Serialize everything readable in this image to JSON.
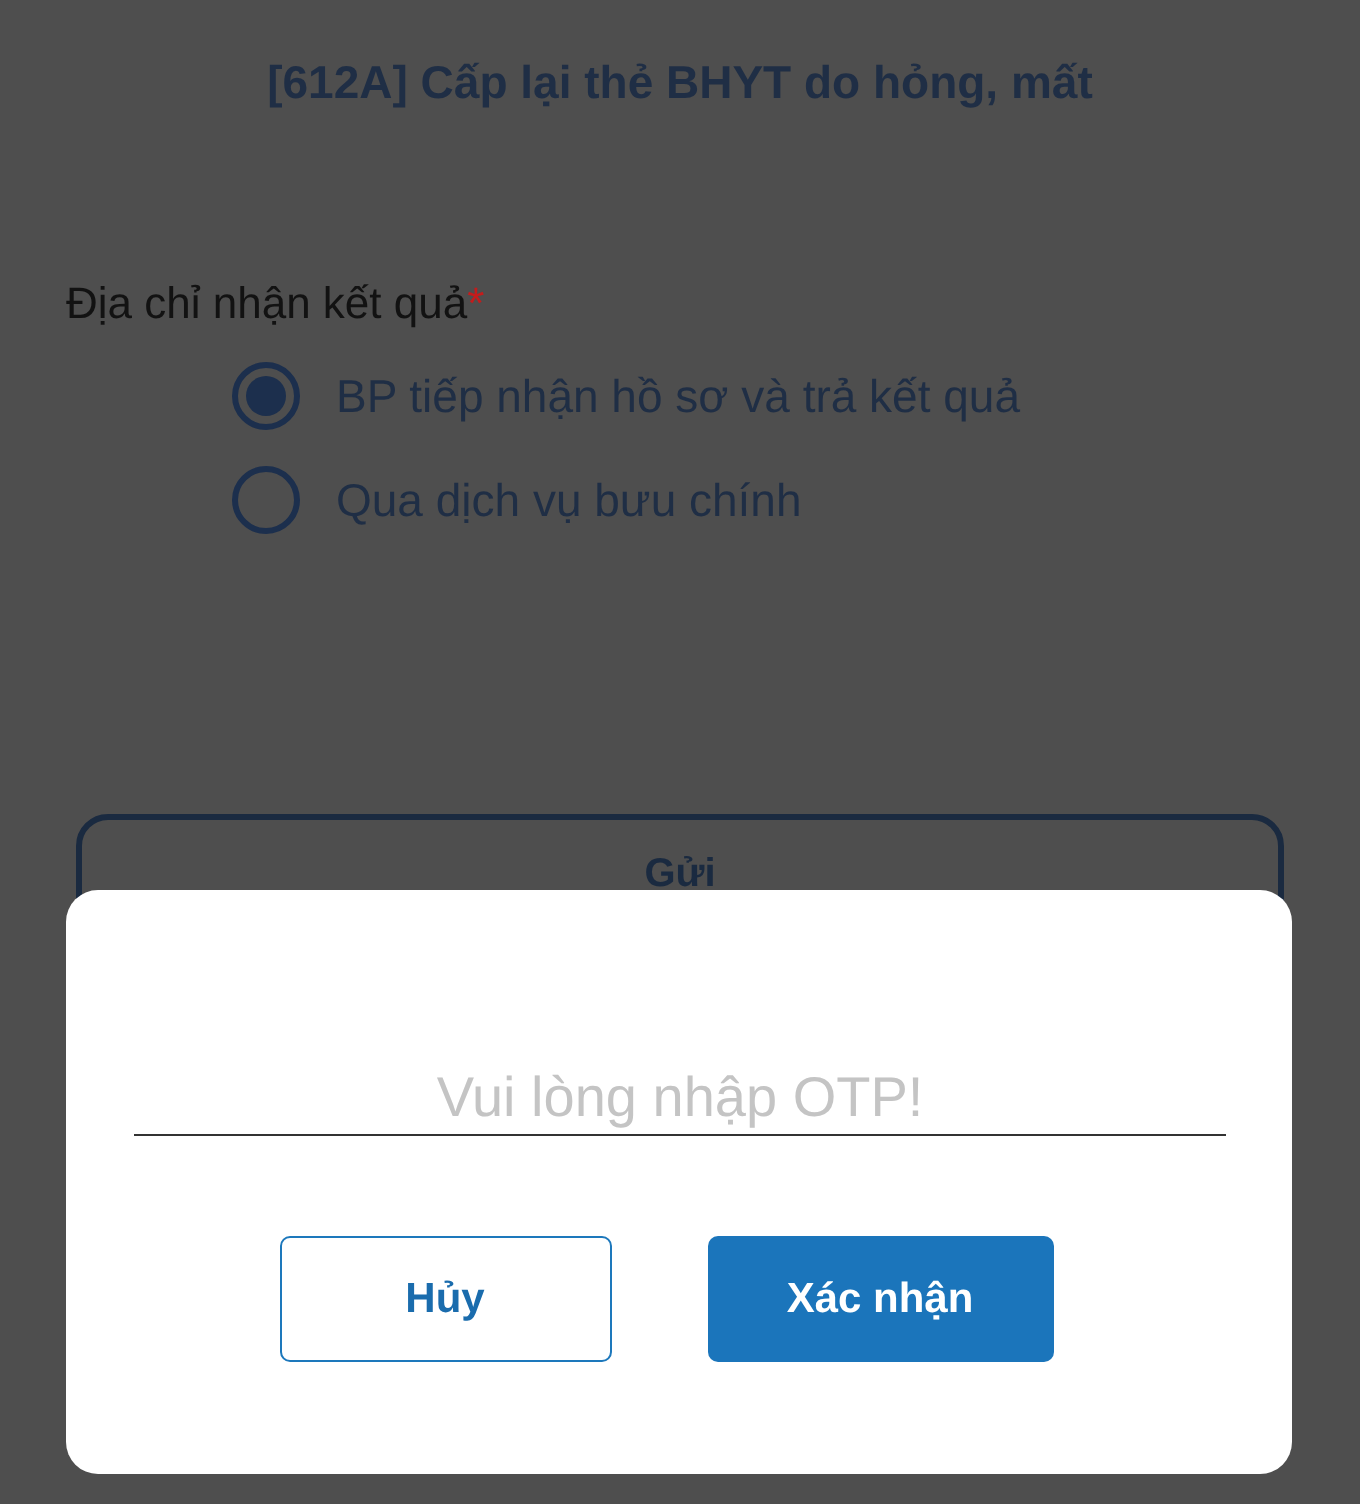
{
  "title": "[612A] Cấp lại thẻ BHYT do hỏng, mất",
  "address_field": {
    "label": "Địa chỉ nhận kết quả",
    "required_mark": "*",
    "options": [
      {
        "label": "BP tiếp nhận hồ sơ và trả kết quả",
        "selected": true
      },
      {
        "label": "Qua dịch vụ bưu chính",
        "selected": false
      }
    ]
  },
  "submit_button": "Gửi",
  "otp_dialog": {
    "otp_field": {
      "placeholder": "Vui lòng nhập OTP!"
    },
    "buttons": [
      {
        "label": "Hủy",
        "kind": "secondary"
      },
      {
        "label": "Xác nhận",
        "kind": "primary"
      }
    ]
  }
}
